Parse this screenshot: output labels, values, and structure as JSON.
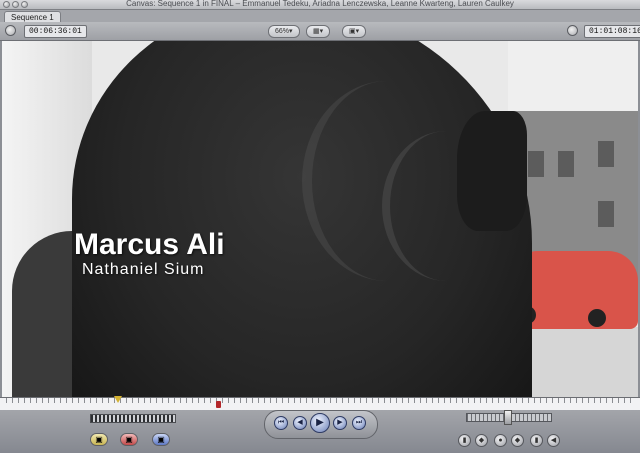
{
  "window": {
    "title": "Canvas: Sequence 1 in FINAL – Emmanuel Tedeku, Ariadna Lenczewska, Leanne Kwarteng, Lauren Caulkey"
  },
  "tabs": [
    {
      "label": "Sequence 1"
    }
  ],
  "controls": {
    "current_timecode": "00:06:36:01",
    "duration_timecode": "01:01:08:16",
    "zoom_label": "66%",
    "view_icon": "view-mode-icon",
    "overlay_icon": "overlay-icon"
  },
  "lower_third": {
    "name": "Marcus Ali",
    "subtitle": "Nathaniel Sium"
  },
  "transport": {
    "buttons": [
      "mark-in-icon",
      "step-back-icon",
      "play-icon",
      "step-forward-icon",
      "mark-out-icon"
    ],
    "edit_buttons": [
      "insert-edit-icon",
      "overwrite-edit-icon",
      "replace-edit-icon"
    ],
    "marker_buttons": [
      "match-frame-icon",
      "add-keyframe-icon",
      "add-marker-icon",
      "mark-clip-icon",
      "mark-in-out-icon"
    ]
  },
  "colors": {
    "accent_play": "#6a7fb6",
    "marker": "#b3262a",
    "playhead": "#d4b233"
  }
}
